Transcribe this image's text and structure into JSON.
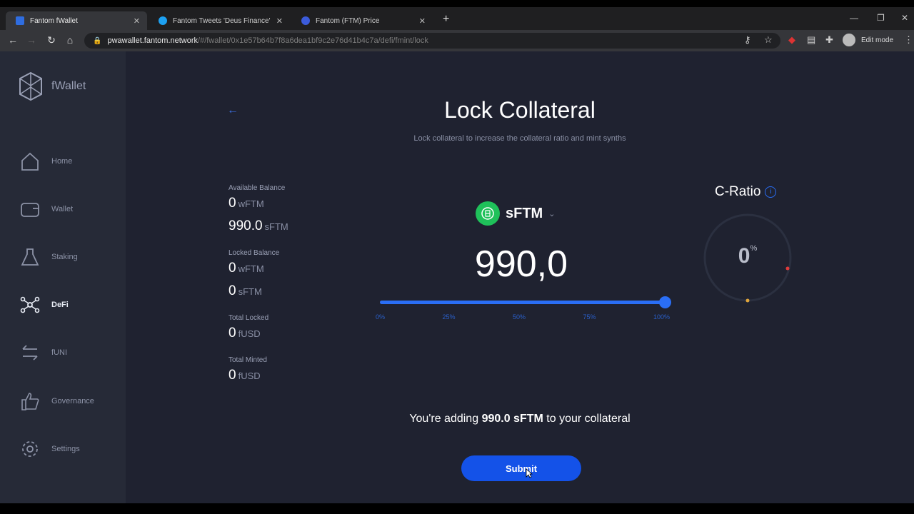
{
  "browser": {
    "tabs": [
      {
        "title": "Fantom fWallet",
        "active": true
      },
      {
        "title": "Fantom Tweets 'Deus Finance'",
        "active": false
      },
      {
        "title": "Fantom (FTM) Price",
        "active": false
      }
    ],
    "url_host": "pwawallet.fantom.network",
    "url_path": "/#/fwallet/0x1e57b64b7f8a6dea1bf9c2e76d41b4c7a/defi/fmint/lock",
    "profile_label": "Edit mode"
  },
  "sidebar": {
    "brand": "fWallet",
    "items": [
      {
        "label": "Home",
        "icon": "home-icon",
        "active": false
      },
      {
        "label": "Wallet",
        "icon": "wallet-icon",
        "active": false
      },
      {
        "label": "Staking",
        "icon": "staking-icon",
        "active": false
      },
      {
        "label": "DeFi",
        "icon": "defi-icon",
        "active": true
      },
      {
        "label": "fUNI",
        "icon": "swap-icon",
        "active": false
      },
      {
        "label": "Governance",
        "icon": "governance-icon",
        "active": false
      },
      {
        "label": "Settings",
        "icon": "gear-icon",
        "active": false
      }
    ]
  },
  "page": {
    "title": "Lock Collateral",
    "subtitle": "Lock collateral to increase the collateral ratio and mint synths",
    "balances": {
      "available_label": "Available Balance",
      "available_wftm_value": "0",
      "available_wftm_unit": "wFTM",
      "available_sftm_value": "990.0",
      "available_sftm_unit": "sFTM",
      "locked_label": "Locked Balance",
      "locked_wftm_value": "0",
      "locked_wftm_unit": "wFTM",
      "locked_sftm_value": "0",
      "locked_sftm_unit": "sFTM",
      "total_locked_label": "Total Locked",
      "total_locked_value": "0",
      "total_locked_unit": "fUSD",
      "total_minted_label": "Total Minted",
      "total_minted_value": "0",
      "total_minted_unit": "fUSD"
    },
    "token": "sFTM",
    "amount": "990,0",
    "slider_fraction": 1.0,
    "slider_marks": [
      "0%",
      "25%",
      "50%",
      "75%",
      "100%"
    ],
    "cratio_label": "C-Ratio",
    "cratio_value": "0",
    "cratio_unit": "%",
    "adding_prefix": "You're adding",
    "adding_amount": "990.0 sFTM",
    "adding_suffix": "to your collateral",
    "submit_label": "Submit"
  },
  "colors": {
    "accent": "#2a6ef5",
    "token_green": "#1fc15a",
    "background": "#1f2230"
  }
}
